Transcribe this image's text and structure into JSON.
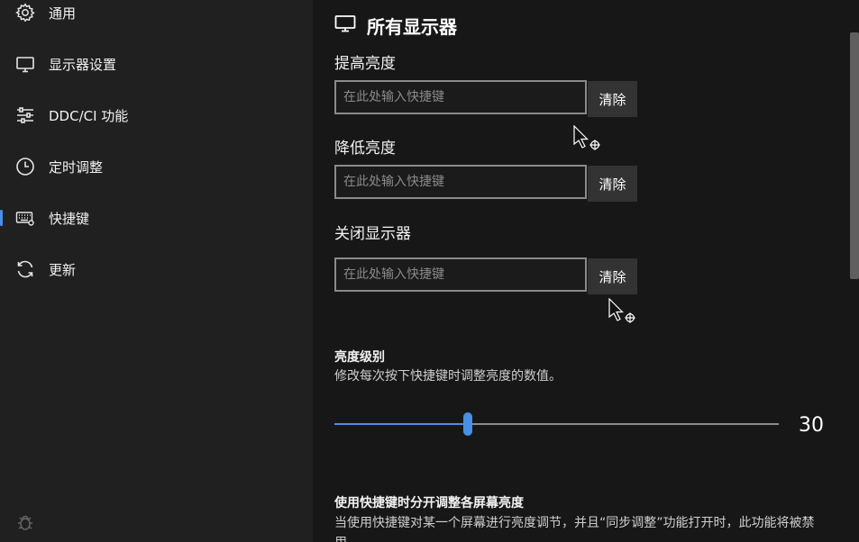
{
  "sidebar": {
    "items": [
      {
        "label": "通用",
        "icon": "gear-icon"
      },
      {
        "label": "显示器设置",
        "icon": "monitor-icon"
      },
      {
        "label": "DDC/CI 功能",
        "icon": "sliders-icon"
      },
      {
        "label": "定时调整",
        "icon": "clock-icon"
      },
      {
        "label": "快捷键",
        "icon": "keyboard-icon",
        "active": true
      },
      {
        "label": "更新",
        "icon": "refresh-icon"
      }
    ],
    "bottom_icon": "bug-icon"
  },
  "main": {
    "section_title": "所有显示器",
    "section_icon": "monitor-icon",
    "hotkeys": [
      {
        "label": "提高亮度",
        "placeholder": "在此处输入快捷键",
        "value": "",
        "clear_label": "清除"
      },
      {
        "label": "降低亮度",
        "placeholder": "在此处输入快捷键",
        "value": "",
        "clear_label": "清除"
      },
      {
        "label": "关闭显示器",
        "placeholder": "在此处输入快捷键",
        "value": "",
        "clear_label": "清除"
      }
    ],
    "brightness_level": {
      "title": "亮度级别",
      "description": "修改每次按下快捷键时调整亮度的数值。",
      "value": 30,
      "value_label": "30",
      "min": 0,
      "max": 100
    },
    "separate_adjust": {
      "title": "使用快捷键时分开调整各屏幕亮度",
      "description": "当使用快捷键对某一个屏幕进行亮度调节，并且“同步调整”功能打开时，此功能将被禁用"
    }
  },
  "colors": {
    "accent": "#4a8fe7",
    "sidebar_bg": "#202020",
    "content_bg": "#171717",
    "button_bg": "#333333"
  }
}
